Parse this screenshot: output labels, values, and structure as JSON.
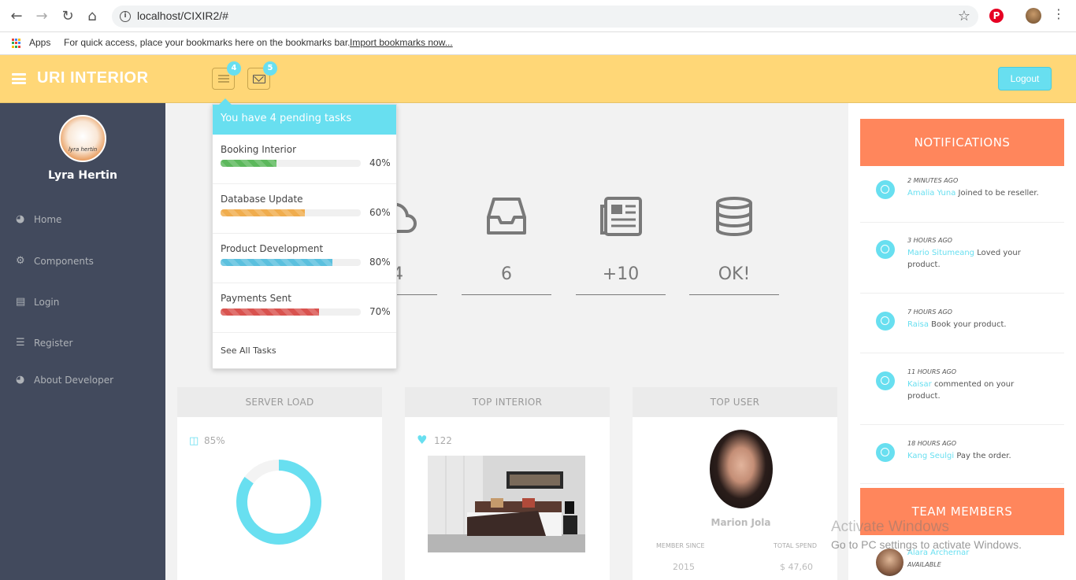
{
  "browser": {
    "url": "localhost/CIXIR2/#",
    "bookmarks": {
      "apps_label": "Apps",
      "hint": "For quick access, place your bookmarks here on the bookmarks bar.",
      "import_link": "Import bookmarks now..."
    }
  },
  "header": {
    "brand": "URI INTERIOR",
    "tasks_badge": "4",
    "mail_badge": "5",
    "logout_label": "Logout",
    "bar_color": "#ffd777",
    "accent_color": "#68dff0"
  },
  "sidebar": {
    "user_name": "Lyra Hertin",
    "avatar_signature": "lyra hertin",
    "items": [
      {
        "label": "Home",
        "icon": "dashboard-icon"
      },
      {
        "label": "Components",
        "icon": "cogs-icon"
      },
      {
        "label": "Login",
        "icon": "book-icon"
      },
      {
        "label": "Register",
        "icon": "tasks-icon"
      },
      {
        "label": "About Developer",
        "icon": "dashboard-icon"
      }
    ]
  },
  "tasks_dropdown": {
    "title": "You have 4 pending tasks",
    "tasks": [
      {
        "name": "Booking Interior",
        "percent": "40%",
        "progress": 0.4,
        "color": "#5cb85c"
      },
      {
        "name": "Database Update",
        "percent": "60%",
        "progress": 0.6,
        "color": "#f0ad4e"
      },
      {
        "name": "Product Development",
        "percent": "80%",
        "progress": 0.8,
        "color": "#5bc0de"
      },
      {
        "name": "Payments Sent",
        "percent": "70%",
        "progress": 0.7,
        "color": "#d9534f"
      }
    ],
    "see_all": "See All Tasks"
  },
  "stats": [
    {
      "icon": "cloud-icon",
      "value": "04"
    },
    {
      "icon": "inbox-icon",
      "value": "6"
    },
    {
      "icon": "newspaper-icon",
      "value": "+10"
    },
    {
      "icon": "database-icon",
      "value": "OK!"
    }
  ],
  "panels": {
    "server_load": {
      "title": "SERVER LOAD",
      "value": "85%",
      "fraction": 0.85
    },
    "top_interior": {
      "title": "TOP INTERIOR",
      "likes": "122"
    },
    "top_user": {
      "title": "TOP USER",
      "name": "Marion Jola",
      "member_since_label": "MEMBER SINCE",
      "member_since": "2015",
      "total_spend_label": "TOTAL SPEND",
      "total_spend": "$ 47,60"
    }
  },
  "notifications": {
    "title": "NOTIFICATIONS",
    "items": [
      {
        "time": "2 MINUTES AGO",
        "who": "Amalia Yuna",
        "text": "Joined to be reseller."
      },
      {
        "time": "3 HOURS AGO",
        "who": "Mario Situmeang",
        "text": "Loved your product."
      },
      {
        "time": "7 HOURS AGO",
        "who": "Raisa",
        "text": "Book your product."
      },
      {
        "time": "11 HOURS AGO",
        "who": "Kaisar",
        "text": "commented on your product."
      },
      {
        "time": "18 HOURS AGO",
        "who": "Kang Seulgi",
        "text": "Pay the order."
      }
    ]
  },
  "team": {
    "title": "TEAM MEMBERS",
    "members": [
      {
        "name": "Alara Archernar",
        "status": "AVAILABLE"
      }
    ]
  },
  "watermark": {
    "line1": "Activate Windows",
    "line2": "Go to PC settings to activate Windows."
  }
}
